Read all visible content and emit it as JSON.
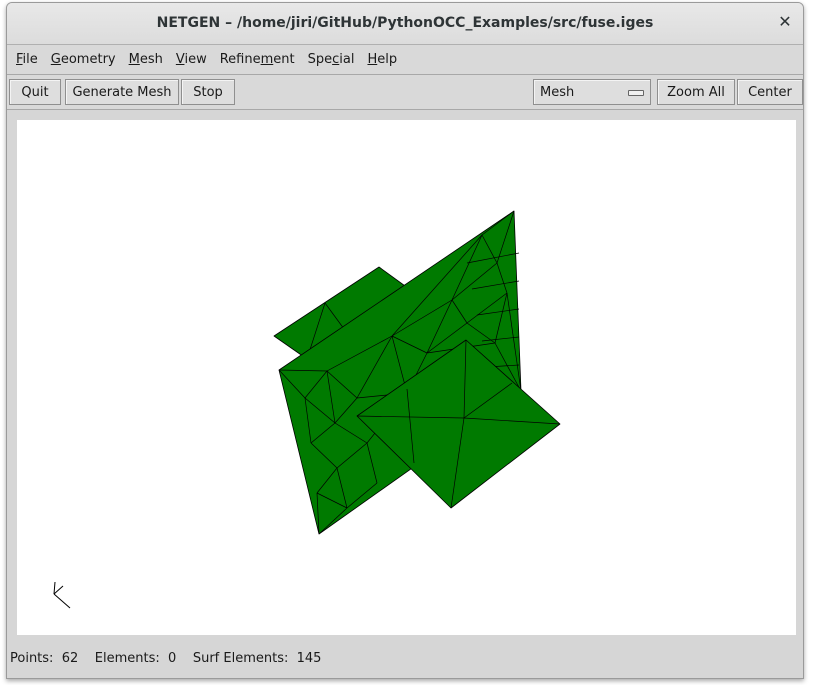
{
  "window": {
    "title": "NETGEN – /home/jiri/GitHub/PythonOCC_Examples/src/fuse.iges",
    "close_glyph": "✕"
  },
  "menu": [
    {
      "pre": "",
      "ul": "F",
      "post": "ile"
    },
    {
      "pre": "",
      "ul": "G",
      "post": "eometry"
    },
    {
      "pre": "",
      "ul": "M",
      "post": "esh"
    },
    {
      "pre": "",
      "ul": "V",
      "post": "iew"
    },
    {
      "pre": "Refine",
      "ul": "m",
      "post": "ent"
    },
    {
      "pre": "Spe",
      "ul": "c",
      "post": "ial"
    },
    {
      "pre": "",
      "ul": "H",
      "post": "elp"
    }
  ],
  "toolbar": {
    "quit": "Quit",
    "generate_mesh": "Generate Mesh",
    "stop": "Stop",
    "view_select": "Mesh",
    "zoom_all": "Zoom All",
    "center": "Center"
  },
  "mesh_view": {
    "fill_color": "#007a00",
    "edge_color": "#000000"
  },
  "status": {
    "points_label": "Points:",
    "points_value": "62",
    "elements_label": "Elements:",
    "elements_value": "0",
    "surf_label": "Surf Elements:",
    "surf_value": "145"
  }
}
